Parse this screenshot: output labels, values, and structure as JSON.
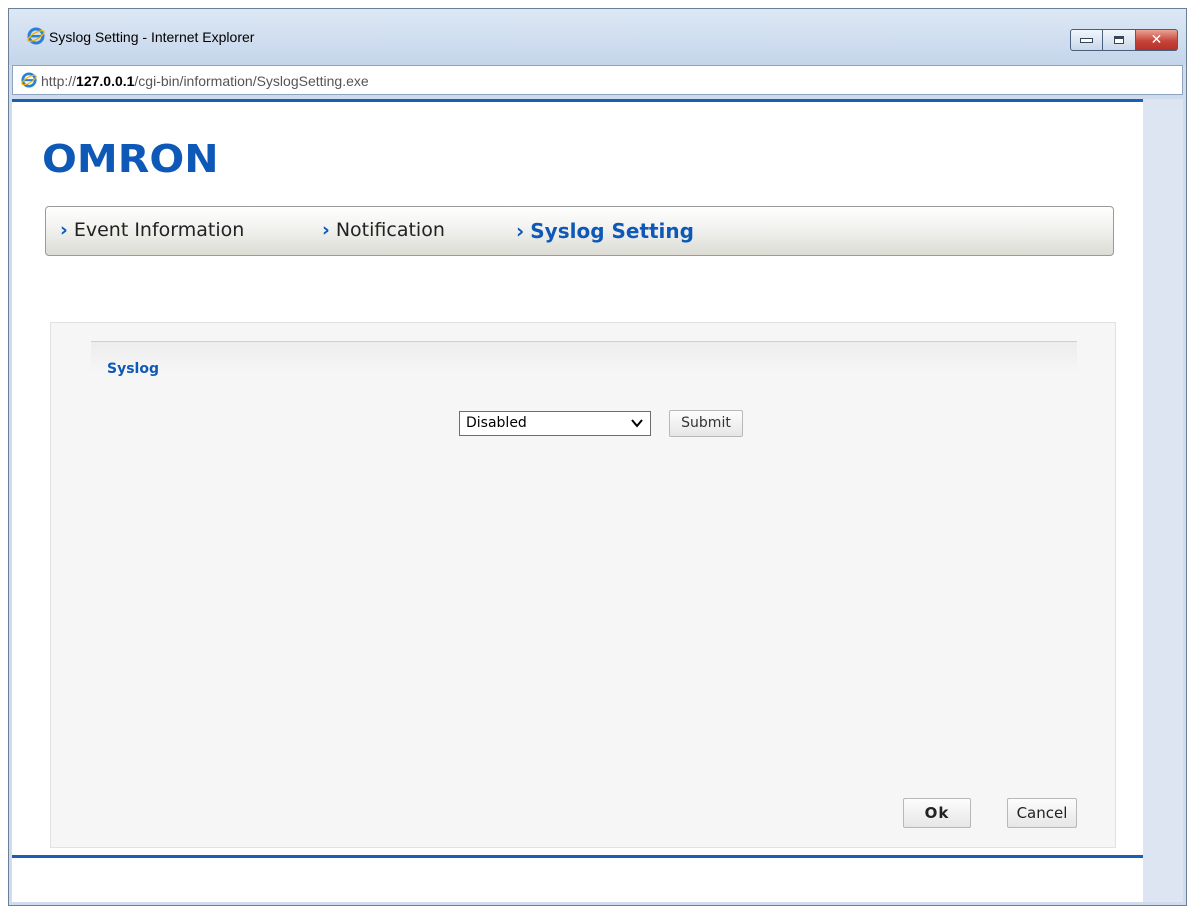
{
  "window": {
    "title": "Syslog Setting - Internet Explorer",
    "address_prefix": "http://",
    "address_host": "127.0.0.1",
    "address_path": "/cgi-bin/information/SyslogSetting.exe"
  },
  "brand": {
    "logo_text": "OMRON",
    "color": "#0e59b7"
  },
  "nav": {
    "items": [
      {
        "label": "Event Information",
        "active": false
      },
      {
        "label": "Notification",
        "active": false
      },
      {
        "label": "Syslog Setting",
        "active": true
      }
    ],
    "chevron": "›"
  },
  "syslog": {
    "section_title": "Syslog",
    "select_value": "Disabled",
    "submit_label": "Submit"
  },
  "footer": {
    "ok_label": "Ok",
    "cancel_label": "Cancel"
  },
  "icons": {
    "title_icon": "ie-icon",
    "address_icon": "ie-icon",
    "minimize": "minimize-icon",
    "maximize": "maximize-icon",
    "close": "close-icon"
  }
}
